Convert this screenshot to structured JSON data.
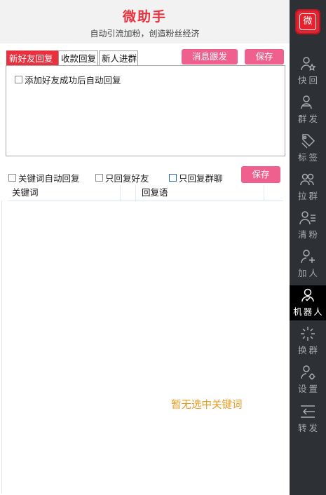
{
  "app": {
    "title": "微助手",
    "subtitle": "自动引流加粉，创造粉丝经济"
  },
  "tabs": [
    {
      "label": "新好友回复",
      "active": true
    },
    {
      "label": "收款回复",
      "active": false
    },
    {
      "label": "新人进群",
      "active": false
    }
  ],
  "actions": {
    "message_follow_label": "消息跟发",
    "save_label": "保存",
    "save_label_2": "保存"
  },
  "new_friend": {
    "auto_reply_label": "添加好友成功后自动回复",
    "auto_reply_checked": false
  },
  "filters": {
    "keyword_auto_reply": "关键词自动回复",
    "friends_only": "只回复好友",
    "groups_only": "只回复群聊"
  },
  "table": {
    "columns": [
      "关键词",
      "回复语"
    ],
    "rows": [],
    "empty_message": "暂无选中关键词"
  },
  "colors": {
    "brand_red": "#e8313f",
    "button_pink": "#f0608f",
    "sidebar_bg": "#2d3035",
    "empty_text": "#e89a20"
  },
  "logo": {
    "glyph": "微"
  },
  "sidebar": {
    "items": [
      {
        "label": "快回",
        "icon": "user-star-icon",
        "active": false
      },
      {
        "label": "群发",
        "icon": "users-send-icon",
        "active": false
      },
      {
        "label": "标签",
        "icon": "tag-icon",
        "active": false
      },
      {
        "label": "拉群",
        "icon": "group-pull-icon",
        "active": false
      },
      {
        "label": "清粉",
        "icon": "user-list-icon",
        "active": false
      },
      {
        "label": "加人",
        "icon": "user-add-icon",
        "active": false
      },
      {
        "label": "机器人",
        "icon": "robot-icon",
        "active": true
      },
      {
        "label": "换群",
        "icon": "sparkle-icon",
        "active": false
      },
      {
        "label": "设置",
        "icon": "user-gear-icon",
        "active": false
      },
      {
        "label": "转发",
        "icon": "forward-icon",
        "active": false
      }
    ]
  }
}
